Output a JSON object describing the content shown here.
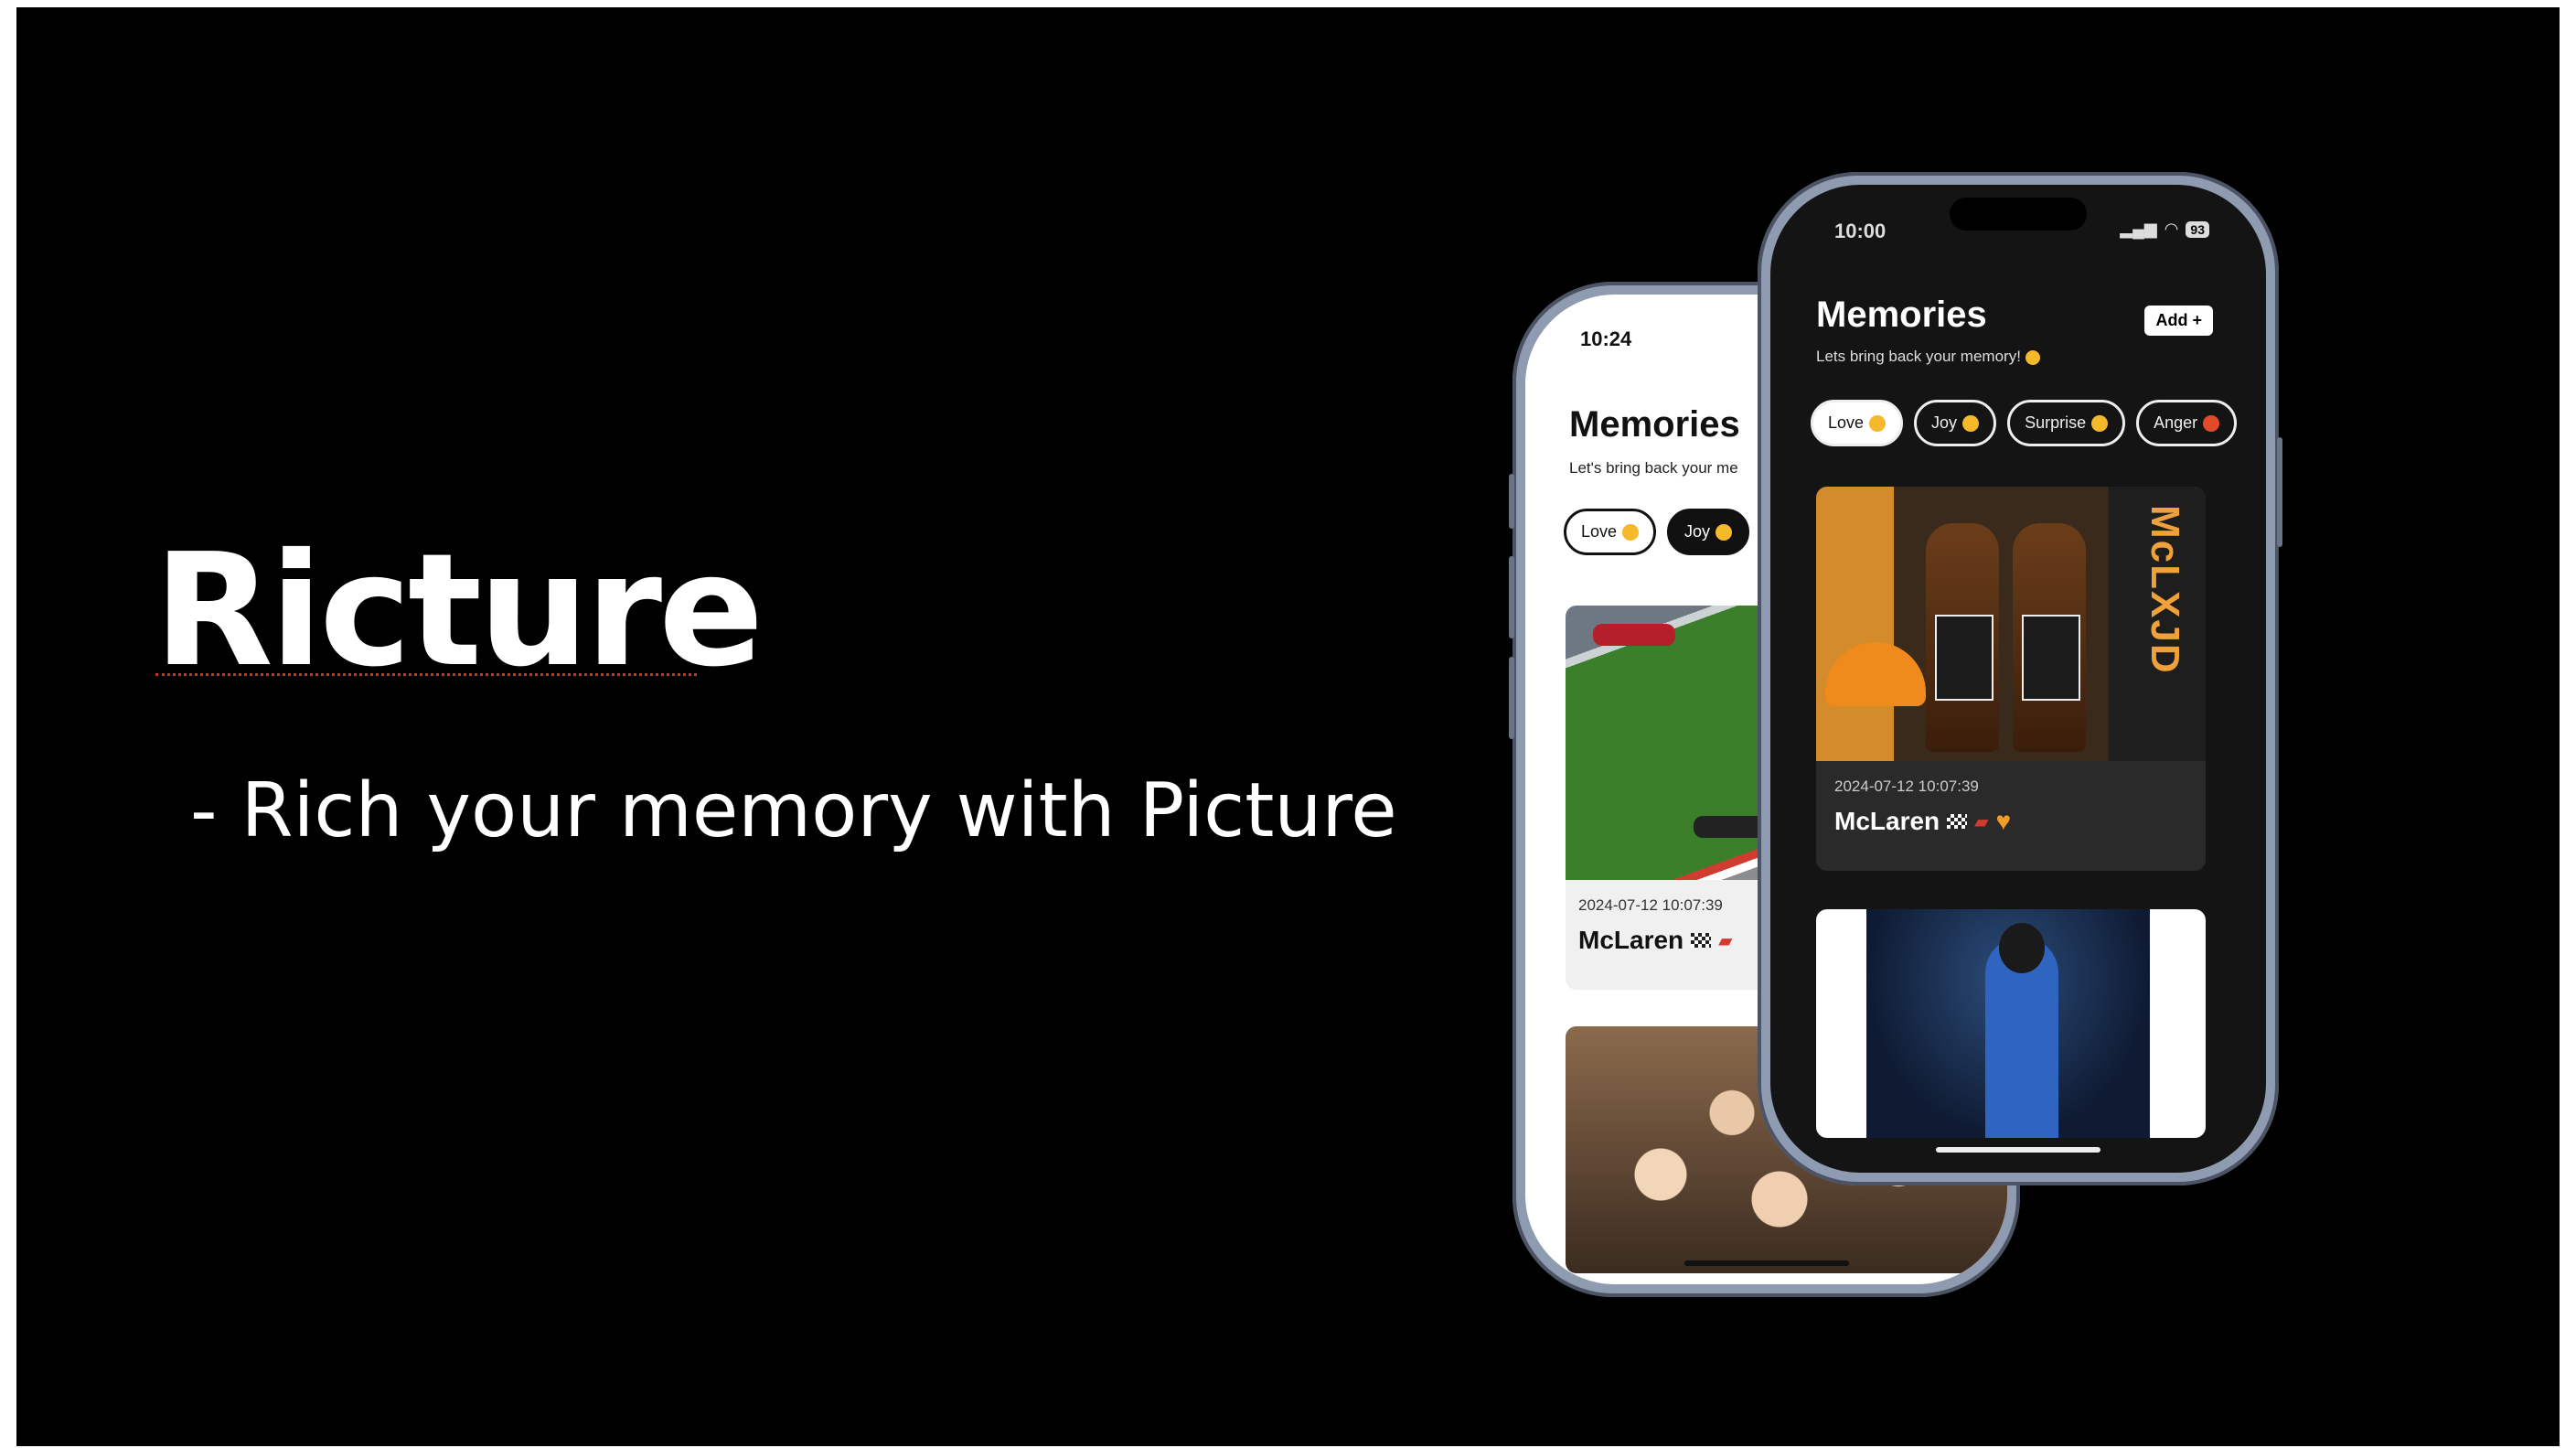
{
  "slide": {
    "title": "Ricture",
    "subtitle": "- Rich your memory with Picture"
  },
  "back_phone": {
    "time": "10:24",
    "app_title": "Memories",
    "app_subtitle": "Let's bring back your me",
    "chips": [
      "Love",
      "Joy"
    ],
    "active_chip": "Joy",
    "card1": {
      "date": "2024-07-12 10:07:39",
      "title": "McLaren"
    }
  },
  "front_phone": {
    "time": "10:00",
    "battery": "93",
    "app_title": "Memories",
    "app_subtitle": "Lets bring back your memory!",
    "add_button": "Add +",
    "chips": [
      "Love",
      "Joy",
      "Surprise",
      "Anger"
    ],
    "active_chip": "Love",
    "card1": {
      "date": "2024-07-12 10:07:39",
      "title": "McLaren",
      "box_text": "McLXJD"
    }
  },
  "colors": {
    "background": "#000000",
    "phone_frame": "#8f9bb1",
    "accent_orange": "#f39c28"
  },
  "icons": [
    "signal-icon",
    "wifi-icon",
    "battery-icon",
    "checkered-flag-icon",
    "race-car-icon",
    "heart-icon"
  ]
}
